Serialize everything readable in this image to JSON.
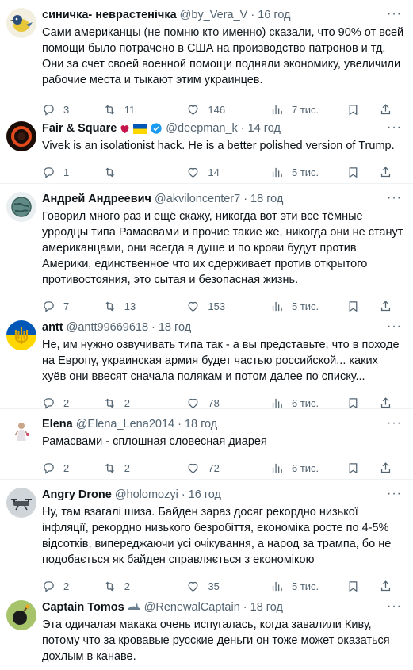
{
  "menu_glyph": "···",
  "tweets": [
    {
      "name": "синичка- неврастенічка",
      "handle": "@by_Vera_V",
      "time": "16 год",
      "text": "Сами американцы (не помню кто именно) сказали, что 90% от всей помощи было потрачено в США на производство патронов и тд. Они за счет своей военной помощи подняли экономику, увеличили рабочие места и тыкают этим украинцев.",
      "replies": "3",
      "retweets": "11",
      "likes": "146",
      "views": "7 тис.",
      "avatar": "bird-drawing"
    },
    {
      "name": "Fair & Square",
      "handle": "@deepman_k",
      "time": "14 год",
      "text": "Vivek is an isolationist hack. He is a better polished version of Trump.",
      "replies": "1",
      "retweets": "",
      "likes": "14",
      "views": "5 тис.",
      "avatar": "red-ring",
      "badges": [
        "heart",
        "ukraine-flag",
        "verified"
      ]
    },
    {
      "name": "Андрей Андреевич",
      "handle": "@akviloncenter7",
      "time": "18 год",
      "text": "Говорил много раз и ещё скажу, никогда вот эти все тёмные урродцы типа Рамасвами и прочие такие же, никогда они не станут американцами, они всегда в душе и по крови будут против Америки, единственное что их сдерживает против открытого противостояния, это сытая и безопасная жизнь.",
      "replies": "7",
      "retweets": "13",
      "likes": "153",
      "views": "5 тис.",
      "avatar": "globe"
    },
    {
      "name": "antt",
      "handle": "@antt99669618",
      "time": "18 год",
      "text": "Не, им нужно озвучивать типа так - а вы представьте, что в походе на Европу, украинская армия будет частью российской... каких хуёв они ввесят сначала полякам и потом далее по списку...",
      "replies": "2",
      "retweets": "2",
      "likes": "78",
      "views": "6 тис.",
      "avatar": "trident"
    },
    {
      "name": "Elena",
      "handle": "@Elena_Lena2014",
      "time": "18 год",
      "text": "Рамасвами - сплошная словесная диарея",
      "replies": "2",
      "retweets": "2",
      "likes": "72",
      "views": "6 тис.",
      "avatar": "figure"
    },
    {
      "name": "Angry Drone",
      "handle": "@holomozyi",
      "time": "16 год",
      "text": "Ну, там взагалі шиза. Байден зараз досяг рекордно низької інфляції, рекордно низького безробіття, економіка росте по 4-5% відсотків, випереджаючи усі очікування, а народ за трампа, бо не подобається як байден справляється з економікою",
      "replies": "2",
      "retweets": "2",
      "likes": "35",
      "views": "5 тис.",
      "avatar": "drone"
    },
    {
      "name": "Captain Tomos",
      "handle": "@RenewalCaptain",
      "time": "18 год",
      "text": "Эта одичалая макака очень испугалась, когда завалили Киву, потому что за кровавые русские деньги он тоже может оказаться дохлым в канаве.",
      "avatar": "bomb",
      "badges": [
        "shark"
      ]
    }
  ],
  "colors": {
    "text": "#0f1419",
    "muted": "#536471",
    "verified": "#1d9bf0",
    "divider": "#eff3f4"
  }
}
